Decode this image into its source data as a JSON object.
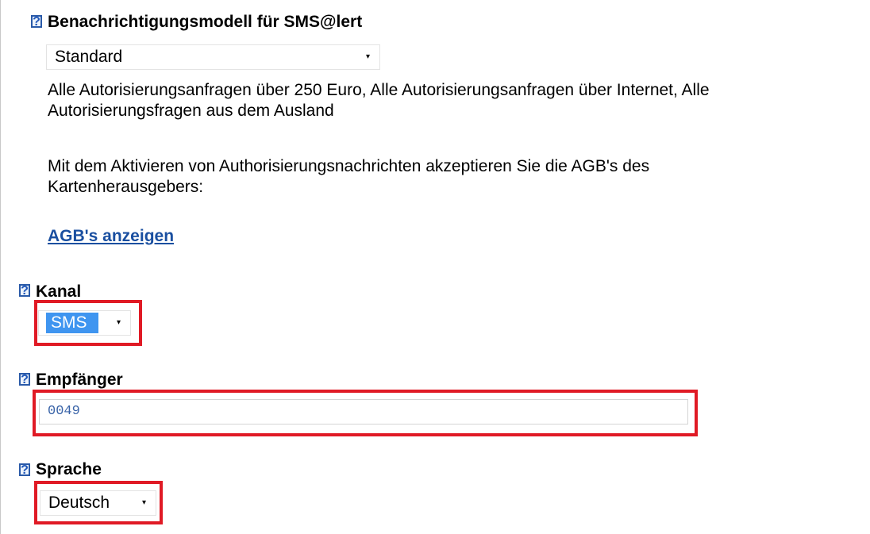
{
  "sections": {
    "model": {
      "heading": "Benachrichtigungsmodell für SMS@lert",
      "select_value": "Standard",
      "description": "Alle Autorisierungsanfragen über 250 Euro, Alle Autorisierungsanfragen über Internet, Alle Autorisierungsfragen aus dem Ausland",
      "agb_notice": "Mit dem Aktivieren von Authorisierungsnachrichten akzeptieren Sie die AGB's des Kartenherausgebers:",
      "agb_link": "AGB's anzeigen"
    },
    "kanal": {
      "heading": "Kanal",
      "select_value": "SMS"
    },
    "empfaenger": {
      "heading": "Empfänger",
      "input_value": "0049"
    },
    "sprache": {
      "heading": "Sprache",
      "select_value": "Deutsch"
    }
  },
  "help_glyph": "?",
  "caret_glyph": "▾",
  "colors": {
    "highlight": "#e01a25",
    "link": "#1a4fa0",
    "help": "#2a5aa8",
    "selection": "#3f95f0"
  }
}
